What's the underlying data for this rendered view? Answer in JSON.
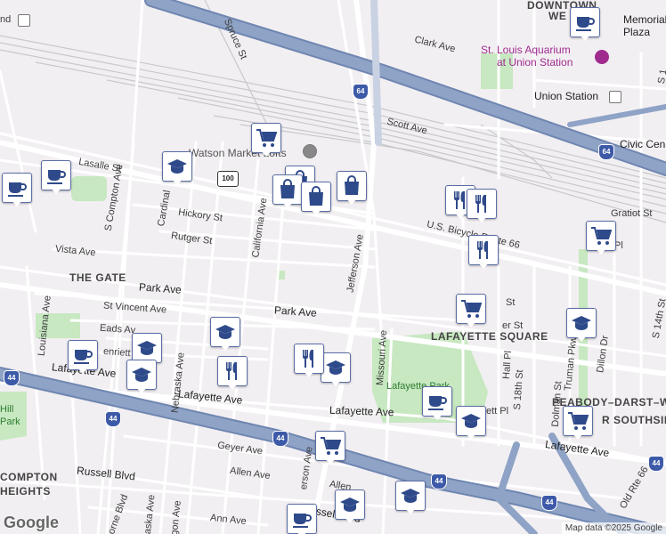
{
  "map": {
    "neighborhoods": {
      "downtown_west_1": "DOWNTOWN",
      "downtown_west_2": "WE",
      "the_gate": "THE GATE",
      "lafayette_square": "LAFAYETTE SQUARE",
      "peabody": "PEABODY–DARST–WEBBE",
      "compton_heights_1": "COMPTON",
      "compton_heights_2": "HEIGHTS",
      "southside": "R SOUTHSIDE"
    },
    "streets": {
      "clark": "Clark Ave",
      "scott": "Scott Ave",
      "lasalle": "Lasalle St",
      "hickory": "Hickory St",
      "rutger": "Rutger St",
      "vista": "Vista Ave",
      "park1": "Park Ave",
      "park2": "Park Ave",
      "st_vincent": "St Vincent Ave",
      "eads": "Eads Av",
      "henrietta": "enriett",
      "lafayette1": "Lafayette Ave",
      "lafayette2": "Lafayette Ave",
      "lafayette3": "Lafayette Ave",
      "lafayette4": "Lafayette Ave",
      "geyer": "Geyer Ave",
      "allen": "Allen Ave",
      "allen2": "Allen",
      "russell": "Russell Blvd",
      "russell2": "ussell Blvd",
      "ann": "Ann Ave",
      "gratiot": "Gratiot St",
      "civic": "Civic Cen",
      "union_station": "Union Station",
      "us_bicycle": "U.S. Bicycle Route 66",
      "spruce": "Spruce St",
      "s_compton": "S Compton Ave",
      "cardinal": "Cardinal",
      "california": "California Ave",
      "jefferson": "Jefferson Ave",
      "jefferson2": "erson Ave",
      "louisiana": "Louisiana Ave",
      "nebraska": "Nebraska Ave",
      "nebraska2": "aska Ave",
      "missouri": "Missouri Ave",
      "hall_pl": "Hall Pl",
      "s_18th": "S 18th St",
      "dolman": "Dolman St",
      "truman": "Truman Pkwy",
      "dillon": "Dillon Dr",
      "s_14th": "S 14th St",
      "old_rte_66": "Old Rte 66",
      "lafayette_park": "Lafayette Park",
      "hill_park_1": "Hill",
      "hill_park_2": "Park",
      "pl": "Pl",
      "st": "St",
      "er_st": "er St",
      "ett_pl": "ett Pl",
      "wthorne": "wthorne Blvd",
      "gon_ave": "gon Ave",
      "ind": "nd",
      "memorial_plaza_1": "Memorial",
      "memorial_plaza_2": "Plaza",
      "s1": "S 1"
    },
    "pois": {
      "aquarium_1": "St. Louis Aquarium",
      "aquarium_2": "at Union Station",
      "watson": "Watson Market Lofts"
    },
    "shields": {
      "i64_a": "64",
      "i64_b": "64",
      "i44_a": "44",
      "i44_b": "44",
      "i44_c": "44",
      "i44_d": "44",
      "i44_e": "44",
      "mo100": "100",
      "i44_f": "44"
    },
    "attribution": "Map data ©2025 Google",
    "logo": "Google"
  },
  "markers": [
    {
      "type": "coffee-icon"
    },
    {
      "type": "coffee-icon"
    },
    {
      "type": "coffee-icon"
    },
    {
      "type": "coffee-icon"
    },
    {
      "type": "coffee-icon"
    },
    {
      "type": "coffee-icon"
    },
    {
      "type": "grocery-cart-icon"
    },
    {
      "type": "grocery-cart-icon"
    },
    {
      "type": "grocery-cart-icon"
    },
    {
      "type": "grocery-cart-icon"
    },
    {
      "type": "grocery-cart-icon"
    },
    {
      "type": "school-icon"
    },
    {
      "type": "school-icon"
    },
    {
      "type": "school-icon"
    },
    {
      "type": "school-icon"
    },
    {
      "type": "school-icon"
    },
    {
      "type": "school-icon"
    },
    {
      "type": "school-icon"
    },
    {
      "type": "school-icon"
    },
    {
      "type": "school-icon"
    },
    {
      "type": "shopping-bag-icon"
    },
    {
      "type": "shopping-bag-icon"
    },
    {
      "type": "shopping-bag-icon"
    },
    {
      "type": "shopping-bag-icon"
    },
    {
      "type": "restaurant-icon"
    },
    {
      "type": "restaurant-icon"
    },
    {
      "type": "restaurant-icon"
    },
    {
      "type": "restaurant-icon"
    },
    {
      "type": "restaurant-icon"
    }
  ],
  "colors": {
    "background": "#f2eff2",
    "highway": "#8ea3c6",
    "highway_edge": "#6f86b1",
    "major_road": "#ffffff",
    "park": "#c7e8c0",
    "rail": "#c8c8cc",
    "marker_border": "#5b6ea6",
    "marker_icon": "#2f4a8a",
    "poi_text": "#a02b8f"
  }
}
